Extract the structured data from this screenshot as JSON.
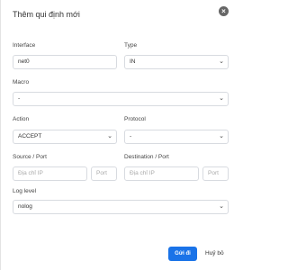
{
  "dialog": {
    "title": "Thêm qui định mới",
    "close_icon": "close-icon"
  },
  "form": {
    "interface": {
      "label": "Interface",
      "value": "net0"
    },
    "type": {
      "label": "Type",
      "value": "IN"
    },
    "macro": {
      "label": "Macro",
      "value": "-"
    },
    "action": {
      "label": "Action",
      "value": "ACCEPT"
    },
    "protocol": {
      "label": "Protocol",
      "value": "-"
    },
    "source": {
      "label": "Source / Port",
      "ip_placeholder": "Địa chỉ IP",
      "port_placeholder": "Port"
    },
    "destination": {
      "label": "Destination / Port",
      "ip_placeholder": "Địa chỉ IP",
      "port_placeholder": "Port"
    },
    "log_level": {
      "label": "Log level",
      "value": "nolog"
    }
  },
  "buttons": {
    "submit": "Gửi đi",
    "cancel": "Huỷ bỏ"
  },
  "colors": {
    "primary": "#1a73e8"
  }
}
